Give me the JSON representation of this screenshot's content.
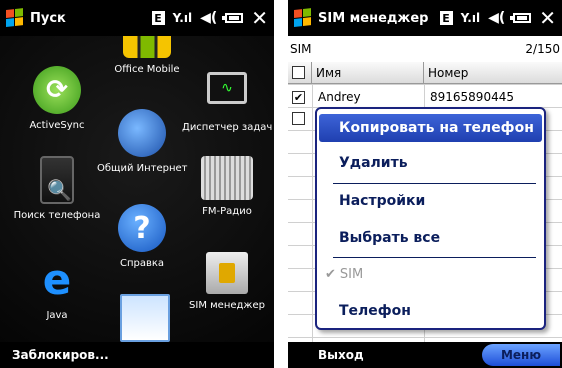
{
  "left": {
    "title": "Пуск",
    "apps": [
      {
        "label": "Office Mobile",
        "icon": "office-mobile-icon"
      },
      {
        "label": "ActiveSync",
        "icon": "activesync-icon"
      },
      {
        "label": "Диспетчер задач",
        "icon": "task-manager-icon"
      },
      {
        "label": "Общий Интернет",
        "icon": "internet-sharing-icon"
      },
      {
        "label": "Поиск телефона",
        "icon": "search-phone-icon"
      },
      {
        "label": "FM-Радио",
        "icon": "fm-radio-icon"
      },
      {
        "label": "Справка",
        "icon": "help-icon"
      },
      {
        "label": "Java",
        "icon": "java-icon"
      },
      {
        "label": "SIM менеджер",
        "icon": "sim-manager-icon"
      }
    ],
    "softkey_left": "Заблокиров..."
  },
  "right": {
    "title": "SIM менеджер",
    "source_label": "SIM",
    "count": "2/150",
    "columns": [
      "Имя",
      "Номер"
    ],
    "rows": [
      {
        "name": "Andrey",
        "number": "89165890445",
        "checked": true
      },
      {
        "name": "",
        "number": "",
        "checked": false
      }
    ],
    "menu": {
      "items": [
        {
          "label": "Копировать на телефон",
          "selected": true
        },
        {
          "label": "Удалить"
        },
        {
          "label": "Настройки"
        },
        {
          "label": "Выбрать все"
        },
        {
          "label": "SIM",
          "disabled": true,
          "checked": true
        },
        {
          "label": "Телефон"
        }
      ]
    },
    "softkey_left": "Выход",
    "softkey_right": "Меню"
  },
  "colors": {
    "accent": "#1f3fb0",
    "menu_text": "#0b1e5c"
  }
}
